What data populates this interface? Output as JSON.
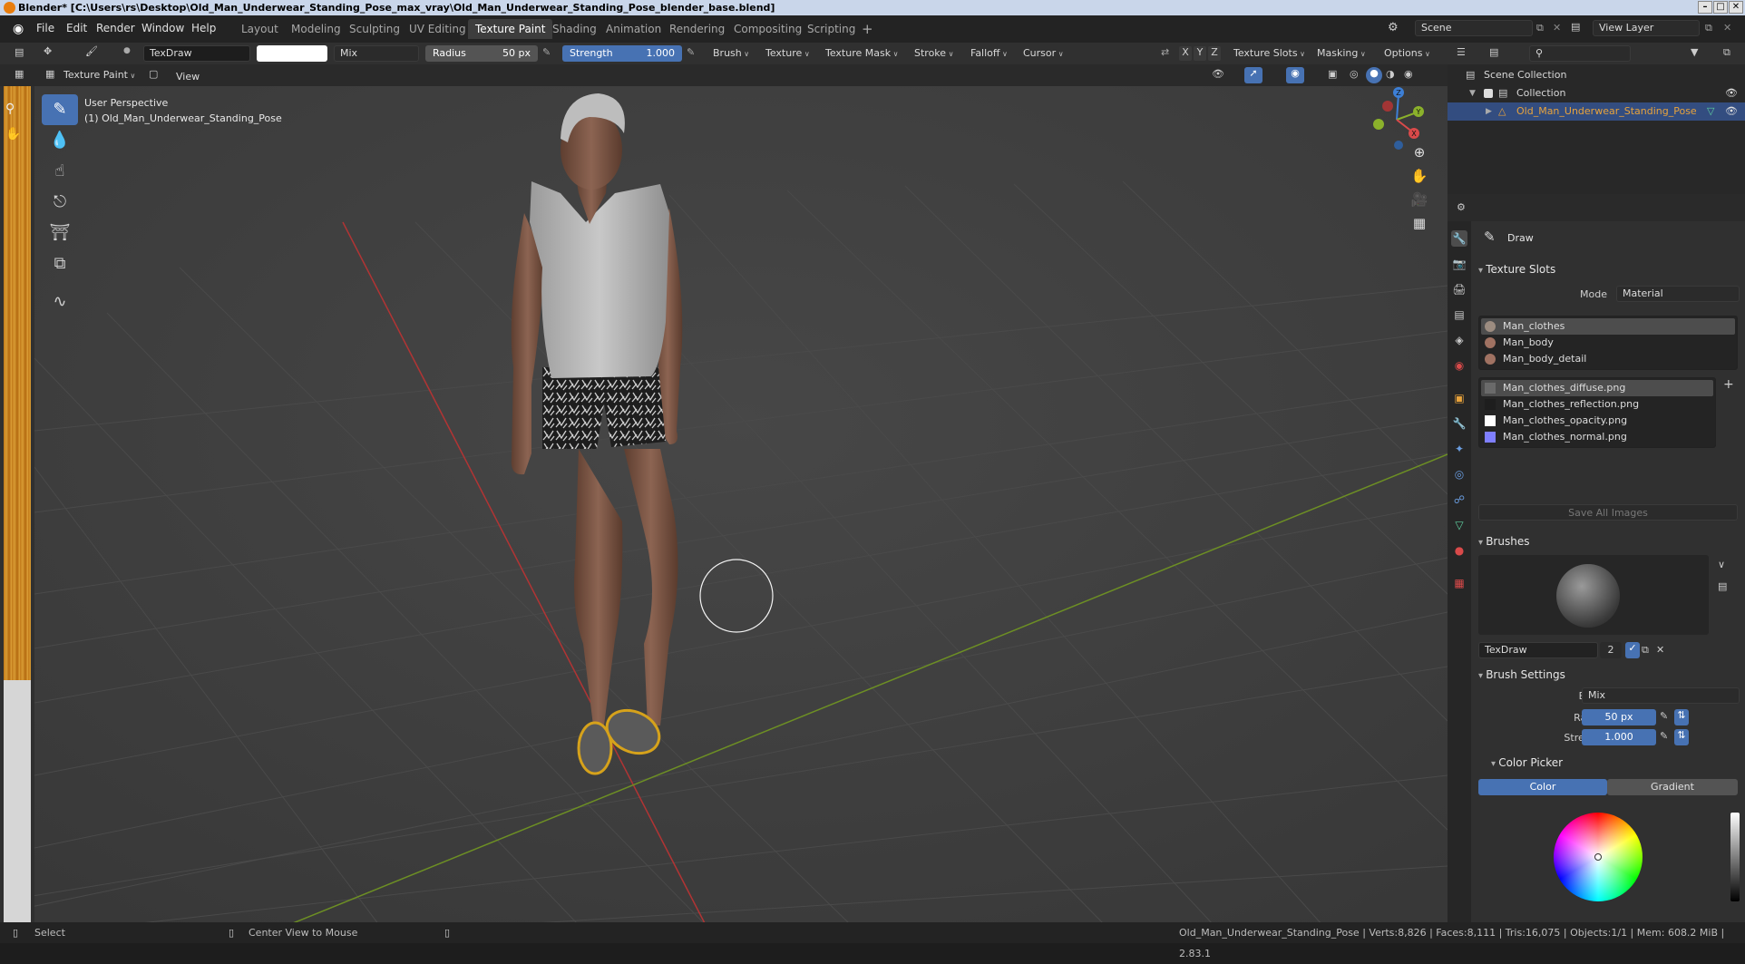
{
  "window": {
    "title": "Blender* [C:\\Users\\rs\\Desktop\\Old_Man_Underwear_Standing_Pose_max_vray\\Old_Man_Underwear_Standing_Pose_blender_base.blend]",
    "controls": [
      "–",
      "□",
      "✕"
    ]
  },
  "menu": {
    "file": "File",
    "edit": "Edit",
    "render": "Render",
    "window": "Window",
    "help": "Help"
  },
  "workspaces": [
    "Layout",
    "Modeling",
    "Sculpting",
    "UV Editing",
    "Texture Paint",
    "Shading",
    "Animation",
    "Rendering",
    "Compositing",
    "Scripting"
  ],
  "active_workspace": "Texture Paint",
  "scene": {
    "label": "Scene",
    "view_layer": "View Layer"
  },
  "tool_header": {
    "brush_name": "TexDraw",
    "blend": "Mix",
    "radius_label": "Radius",
    "radius_value": "50 px",
    "strength_label": "Strength",
    "strength_value": "1.000",
    "menus": [
      "Brush",
      "Texture",
      "Texture Mask",
      "Stroke",
      "Falloff",
      "Cursor"
    ],
    "axes": [
      "X",
      "Y",
      "Z"
    ],
    "right_menus": [
      "Texture Slots",
      "Masking",
      "Options"
    ]
  },
  "header2": {
    "mode": "Texture Paint",
    "view": "View"
  },
  "viewport": {
    "perspective": "User Perspective",
    "object_label": "(1) Old_Man_Underwear_Standing_Pose",
    "gizmo_axes": [
      "Z",
      "Y",
      "X"
    ]
  },
  "outliner": {
    "scene_collection": "Scene Collection",
    "collection": "Collection",
    "object": "Old_Man_Underwear_Standing_Pose"
  },
  "properties": {
    "tool_name": "Draw",
    "texture_slots": {
      "title": "Texture Slots",
      "mode_label": "Mode",
      "mode_value": "Material",
      "materials": [
        "Man_clothes",
        "Man_body",
        "Man_body_detail"
      ],
      "images": [
        "Man_clothes_diffuse.png",
        "Man_clothes_reflection.png",
        "Man_clothes_opacity.png",
        "Man_clothes_normal.png"
      ],
      "image_colors": [
        "#6a6a6a",
        "#1e1e1e",
        "#ffffff",
        "#7f7fff"
      ],
      "save_all": "Save All Images"
    },
    "brushes": {
      "title": "Brushes",
      "name": "TexDraw",
      "users": "2"
    },
    "brush_settings": {
      "title": "Brush Settings",
      "blend_label": "Blend",
      "blend_value": "Mix",
      "radius_label": "Radius",
      "radius_value": "50 px",
      "strength_label": "Strength",
      "strength_value": "1.000"
    },
    "color_picker": {
      "title": "Color Picker",
      "color_tab": "Color",
      "gradient_tab": "Gradient"
    }
  },
  "status": {
    "select": "Select",
    "center": "Center View to Mouse",
    "stats": "Old_Man_Underwear_Standing_Pose | Verts:8,826 | Faces:8,111 | Tris:16,075 | Objects:1/1 | Mem: 608.2 MiB | 2.83.1"
  },
  "colors": {
    "accent": "#4772b3",
    "selected_object": "#e8a33c",
    "x_axis": "#d94a4a",
    "y_axis": "#8bb12b",
    "z_axis": "#3d7fd6"
  }
}
